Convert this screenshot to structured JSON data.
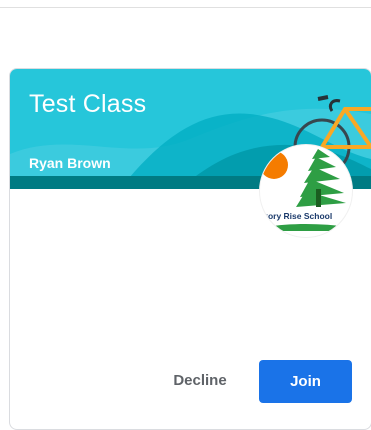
{
  "card": {
    "title": "Test Class",
    "teacher": "Ryan Brown",
    "school_logo_text": "Hickory Rise School",
    "colors": {
      "banner": "#26c6da",
      "banner_strip": "#007b83",
      "primary_button": "#1a73e8"
    }
  },
  "actions": {
    "decline_label": "Decline",
    "join_label": "Join"
  }
}
